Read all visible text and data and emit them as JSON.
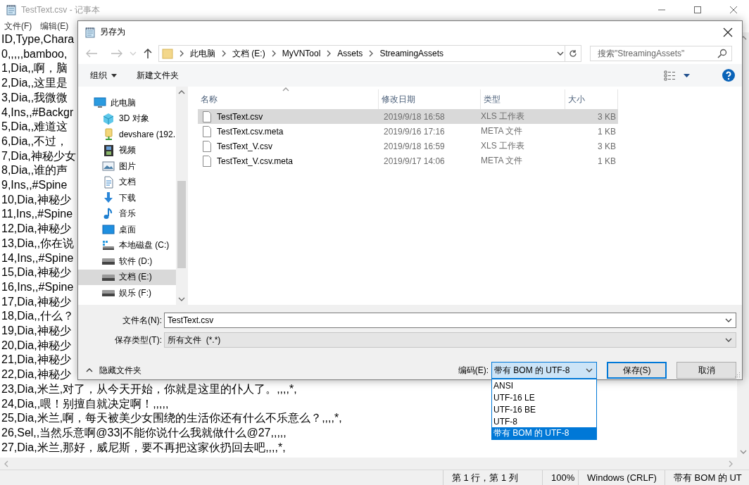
{
  "notepad": {
    "title": "TestText.csv - 记事本",
    "menu": [
      "文件(F)",
      "编辑(E)"
    ],
    "lines": [
      "ID,Type,Chara",
      "0,,,,,bamboo,",
      "1,Dia,,啊，脑",
      "2,Dia,,这里是",
      "3,Dia,,我微微",
      "4,Ins,,#Backgr",
      "5,Dia,,难道这",
      "6,Dia,,不过，",
      "7,Dia,神秘少女",
      "8,Dia,,谁的声",
      "9,Ins,,#Spine",
      "10,Dia,神秘少",
      "11,Ins,,#Spine",
      "12,Dia,神秘少",
      "13,Dia,,你在说",
      "14,Ins,,#Spine",
      "15,Dia,神秘少",
      "16,Ins,,#Spine",
      "17,Dia,神秘少",
      "18,Dia,,什么？",
      "19,Dia,神秘少",
      "20,Dia,神秘少",
      "21,Dia,神秘少",
      "22,Dia,神秘少",
      "23,Dia,米兰,对了，从今天开始，你就是这里的仆人了。,,,,*,",
      "24,Dia,,喂！别擅自就决定啊！,,,,,",
      "25,Dia,米兰,啊，每天被美少女围绕的生活你还有什么不乐意么？,,,,*,",
      "26,Sel,,当然乐意啊@33|不能你说什么我就做什么@27,,,,,",
      "27,Dia,米兰,那好，威尼斯，要不再把这家伙扔回去吧,,,,*,"
    ],
    "status_bar": [
      "第 1 行，第 1 列",
      "100%",
      "Windows (CRLF)",
      "带有 BOM 的 UT"
    ]
  },
  "dialog": {
    "title": "另存为",
    "breadcrumb": [
      "此电脑",
      "文档 (E:)",
      "MyVNTool",
      "Assets",
      "StreamingAssets"
    ],
    "search": {
      "placeholder": "搜索\"StreamingAssets\""
    },
    "toolbar": {
      "organize": "组织",
      "new_folder": "新建文件夹"
    },
    "nav": [
      {
        "label": "此电脑",
        "kind": "computer",
        "selected": false,
        "children": [
          {
            "label": "3D 对象",
            "kind": "cube",
            "selected": false
          },
          {
            "label": "devshare (192.",
            "kind": "network",
            "selected": false
          },
          {
            "label": "视频",
            "kind": "video",
            "selected": false
          },
          {
            "label": "图片",
            "kind": "picture",
            "selected": false
          },
          {
            "label": "文档",
            "kind": "document",
            "selected": false
          },
          {
            "label": "下载",
            "kind": "download",
            "selected": false
          },
          {
            "label": "音乐",
            "kind": "music",
            "selected": false
          },
          {
            "label": "桌面",
            "kind": "desktop",
            "selected": false
          },
          {
            "label": "本地磁盘 (C:)",
            "kind": "system-drive",
            "selected": false
          },
          {
            "label": "软件 (D:)",
            "kind": "drive",
            "selected": false
          },
          {
            "label": "文档 (E:)",
            "kind": "drive",
            "selected": true
          },
          {
            "label": "娱乐 (F:)",
            "kind": "drive",
            "selected": false
          }
        ]
      }
    ],
    "columns": [
      "名称",
      "修改日期",
      "类型",
      "大小"
    ],
    "files": [
      {
        "name": "TestText.csv",
        "date": "2019/9/18 16:58",
        "type": "XLS 工作表",
        "size": "3 KB",
        "selected": true
      },
      {
        "name": "TestText.csv.meta",
        "date": "2019/9/16 17:16",
        "type": "META 文件",
        "size": "1 KB",
        "selected": false
      },
      {
        "name": "TestText_V.csv",
        "date": "2019/9/18 16:59",
        "type": "XLS 工作表",
        "size": "3 KB",
        "selected": false
      },
      {
        "name": "TestText_V.csv.meta",
        "date": "2019/9/17 14:06",
        "type": "META 文件",
        "size": "1 KB",
        "selected": false
      }
    ],
    "filename": {
      "label": "文件名(N):",
      "value": "TestText.csv"
    },
    "filetype": {
      "label": "保存类型(T):",
      "value": "所有文件  (*.*)"
    },
    "hide_folders": "隐藏文件夹",
    "encoding": {
      "label": "编码(E):",
      "value": "带有 BOM 的 UTF-8",
      "options": [
        {
          "label": "ANSI",
          "selected": false
        },
        {
          "label": "UTF-16 LE",
          "selected": false
        },
        {
          "label": "UTF-16 BE",
          "selected": false
        },
        {
          "label": "UTF-8",
          "selected": false
        },
        {
          "label": "带有 BOM 的 UTF-8",
          "selected": true
        }
      ]
    },
    "buttons": [
      {
        "label": "保存(S)",
        "default": true
      },
      {
        "label": "取消",
        "default": false
      }
    ]
  }
}
